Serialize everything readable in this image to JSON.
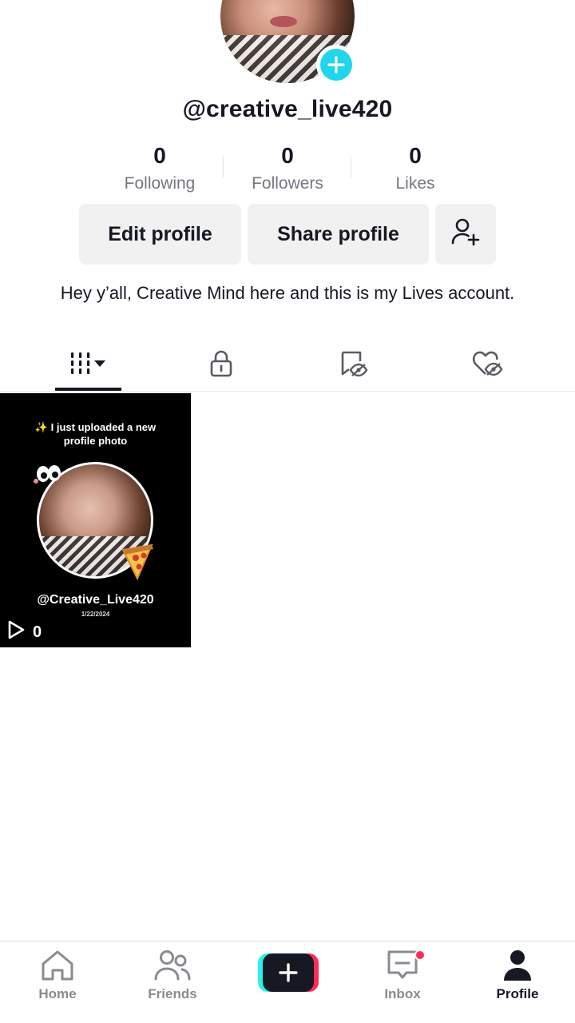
{
  "profile": {
    "username": "@creative_live420",
    "bio": "Hey y’all, Creative Mind here and this is my Lives account."
  },
  "stats": [
    {
      "value": "0",
      "label": "Following"
    },
    {
      "value": "0",
      "label": "Followers"
    },
    {
      "value": "0",
      "label": "Likes"
    }
  ],
  "actions": {
    "edit_label": "Edit profile",
    "share_label": "Share profile",
    "add_friend_icon": "person-add-icon"
  },
  "tabs": [
    {
      "name": "videos",
      "icon": "grid-bars-icon",
      "active": true
    },
    {
      "name": "private",
      "icon": "lock-icon",
      "active": false
    },
    {
      "name": "saved",
      "icon": "bookmark-hidden-icon",
      "active": false
    },
    {
      "name": "liked",
      "icon": "heart-hidden-icon",
      "active": false
    }
  ],
  "videos": [
    {
      "caption": "✨ I just uploaded a new profile photo",
      "handle": "@Creative_Live420",
      "date": "1/22/2024",
      "views": "0"
    }
  ],
  "bottom_nav": [
    {
      "label": "Home",
      "icon": "home-icon"
    },
    {
      "label": "Friends",
      "icon": "friends-icon"
    },
    {
      "label": "",
      "icon": "create-plus-icon"
    },
    {
      "label": "Inbox",
      "icon": "inbox-icon",
      "has_notification": true
    },
    {
      "label": "Profile",
      "icon": "profile-icon",
      "active": true
    }
  ],
  "colors": {
    "accent_cyan": "#20d5ec",
    "accent_pink": "#fe2c55",
    "text_primary": "#161823",
    "text_secondary": "#75777f",
    "button_bg": "#f1f1f2"
  }
}
